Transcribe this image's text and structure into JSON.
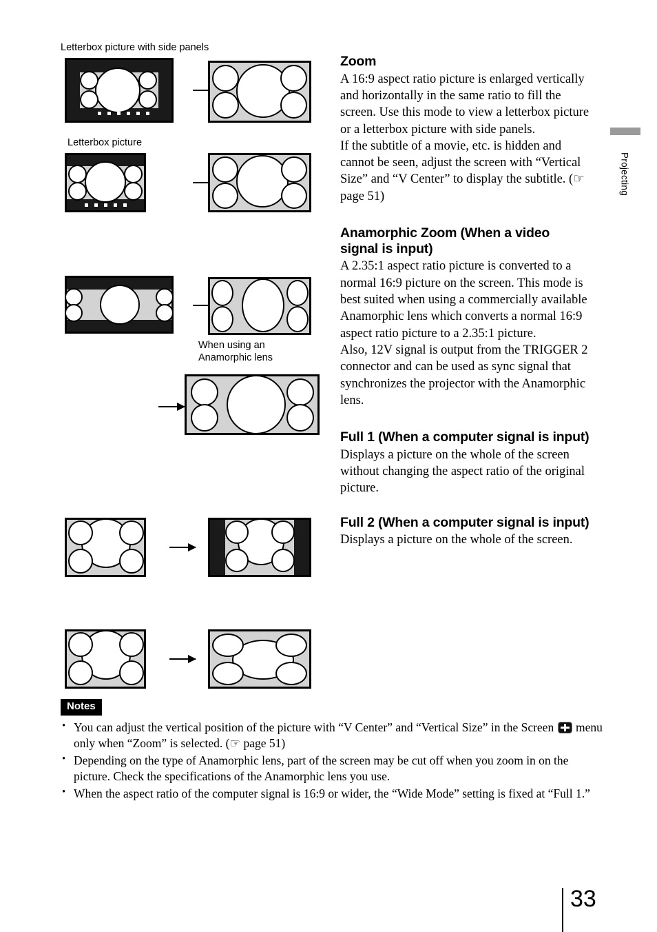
{
  "page": {
    "number": "33",
    "side_tab_label": "Projecting"
  },
  "figures": {
    "caption_letterbox_side_panels": "Letterbox picture with side panels",
    "caption_letterbox": "Letterbox picture",
    "caption_anamorphic_lens": "When using an\nAnamorphic lens",
    "caption_anamorphic_lens_line1": "When using an",
    "caption_anamorphic_lens_line2": "Anamorphic lens"
  },
  "sections": [
    {
      "heading": "Zoom",
      "paragraphs": [
        "A 16:9 aspect ratio picture is enlarged vertically and horizontally in the same ratio to fill the screen. Use this mode to view a letterbox picture or a letterbox picture with side panels.",
        "If the subtitle of a movie, etc. is hidden and cannot be seen, adjust the screen with “Vertical Size” and “V Center” to display the subtitle. (☞ page 51)"
      ]
    },
    {
      "heading": "Anamorphic Zoom (When a video signal is input)",
      "paragraphs": [
        "A 2.35:1 aspect ratio picture is converted to a normal 16:9 picture on the screen. This mode is best suited when using a commercially available Anamorphic lens which converts a normal 16:9 aspect ratio picture to a 2.35:1 picture.",
        "Also, 12V signal is output from the TRIGGER 2 connector and can be used as sync signal that synchronizes the projector with the Anamorphic lens."
      ]
    },
    {
      "heading": "Full 1 (When a computer signal is input)",
      "paragraphs": [
        "Displays a picture on the whole of the screen without changing the aspect ratio of the original picture."
      ]
    },
    {
      "heading": "Full 2 (When a computer signal is input)",
      "paragraphs": [
        "Displays a picture on the whole of the screen."
      ]
    }
  ],
  "notes": {
    "title": "Notes",
    "items": {
      "item1_part1": "You can adjust the vertical position of the picture with “V Center” and “Vertical Size” in the Screen",
      "item1_part2": "menu only when “Zoom” is selected. (☞ page 51)",
      "item2": "Depending on the type of Anamorphic lens, part of the screen may be cut off when you zoom in on the picture. Check the specifications of the Anamorphic lens you use.",
      "item3": "When the aspect ratio of the computer signal is 16:9 or wider, the “Wide Mode” setting is fixed at “Full 1.”"
    }
  },
  "colors": {
    "screen_gray": "#d3d3d3",
    "letterbox_black": "#1a1a1a",
    "tab_gray": "#9a9a9a"
  }
}
